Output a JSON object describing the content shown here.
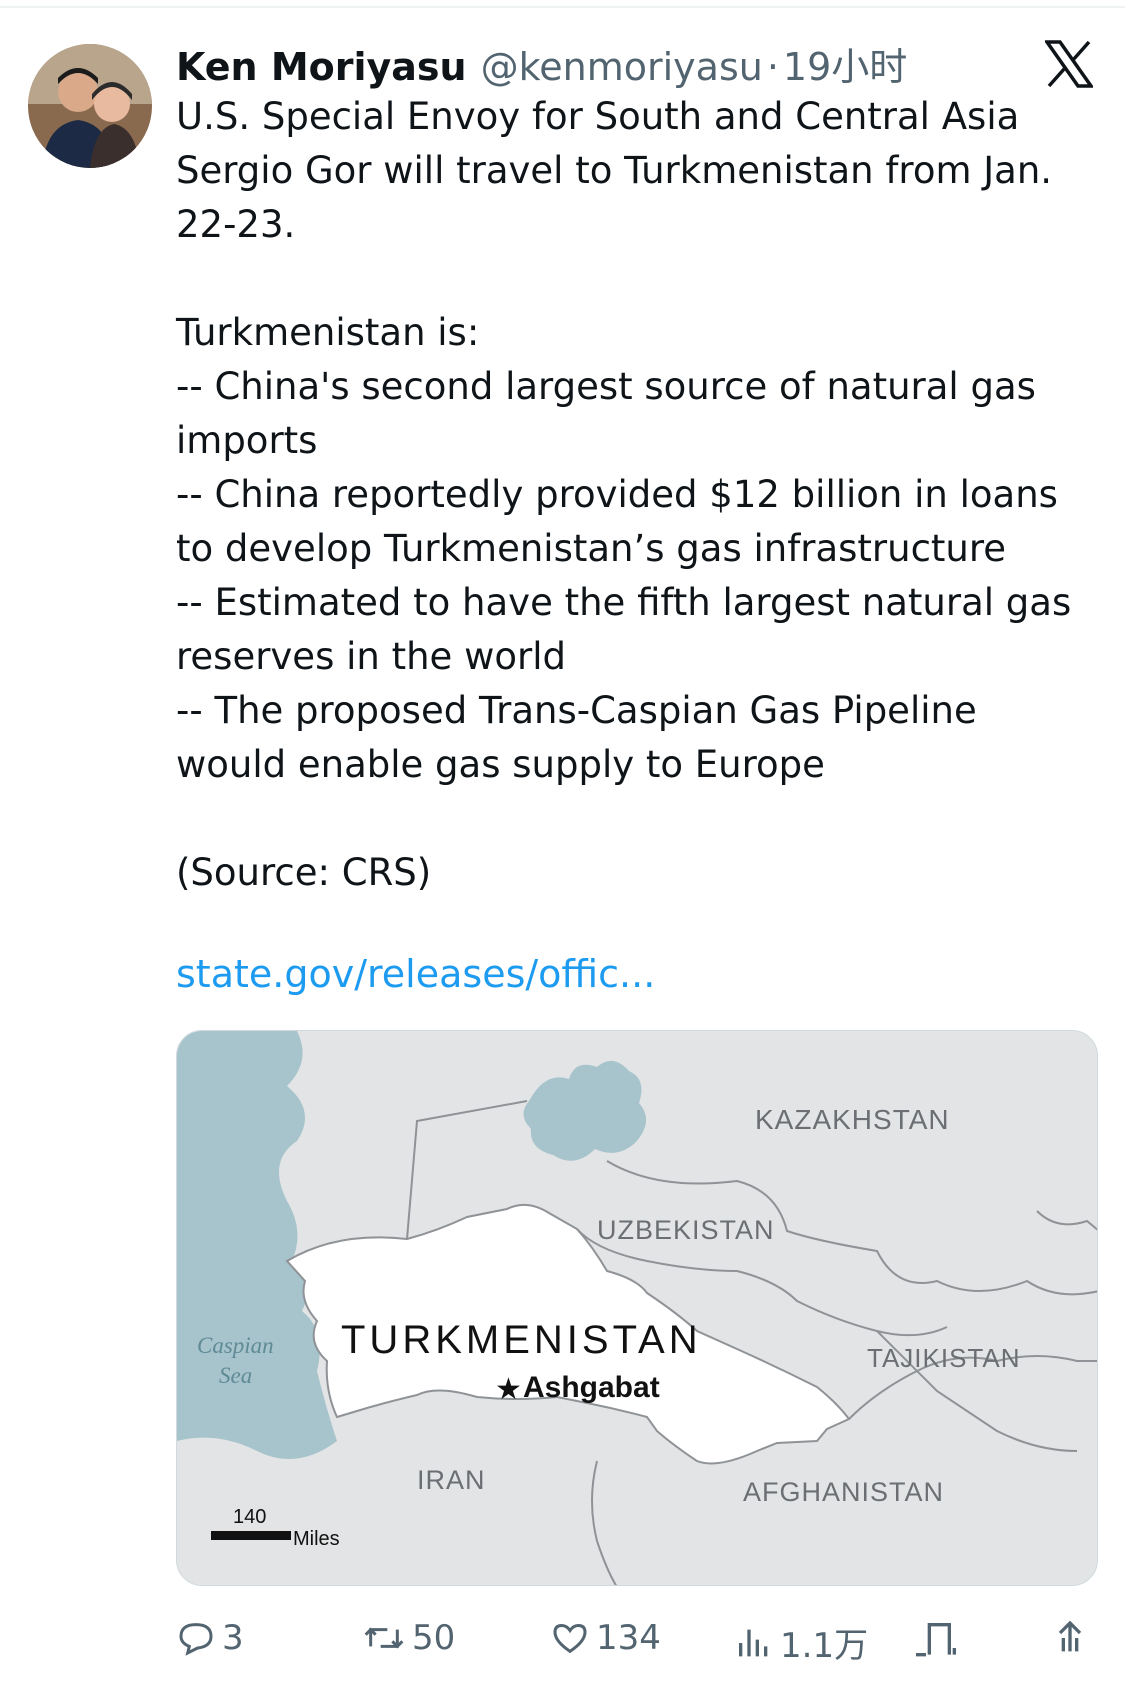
{
  "tweet": {
    "author_name": "Ken Moriyasu",
    "handle": "@kenmoriyasu",
    "separator": "·",
    "time": "19小时",
    "lines": [
      "U.S. Special Envoy for South and Central Asia",
      "Sergio Gor will travel to Turkmenistan from Jan.",
      "22-23.",
      "",
      "Turkmenistan is:",
      "-- China's second largest source of natural gas",
      "imports",
      "-- China reportedly provided $12 billion in loans",
      "to develop Turkmenistan’s gas infrastructure",
      "-- Estimated to have the fifth largest natural gas",
      "reserves in the world",
      "-- The proposed Trans-Caspian Gas Pipeline",
      "would enable gas supply to Europe",
      "",
      "(Source: CRS)"
    ],
    "link_text": "state.gov/releases/offic..."
  },
  "map": {
    "labels": {
      "kazakhstan": "KAZAKHSTAN",
      "uzbekistan": "UZBEKISTAN",
      "turkmenistan": "TURKMENISTAN",
      "capital": "Ashgabat",
      "tajikistan": "TAJIKISTAN",
      "caspian_line1": "Caspian",
      "caspian_line2": "Sea",
      "iran": "IRAN",
      "afghanistan": "AFGHANISTAN",
      "scale_value": "140",
      "scale_unit": "Miles"
    },
    "colors": {
      "land": "#e3e4e5",
      "highlight": "#ffffff",
      "water": "#a7c4cc",
      "border": "#8f9296"
    }
  },
  "actions": {
    "replies": "3",
    "reposts": "50",
    "likes": "134",
    "views": "1.1万"
  },
  "icons": [
    "x-logo-icon",
    "reply-icon",
    "repost-icon",
    "like-icon",
    "views-icon",
    "bookmark-icon",
    "share-icon"
  ]
}
